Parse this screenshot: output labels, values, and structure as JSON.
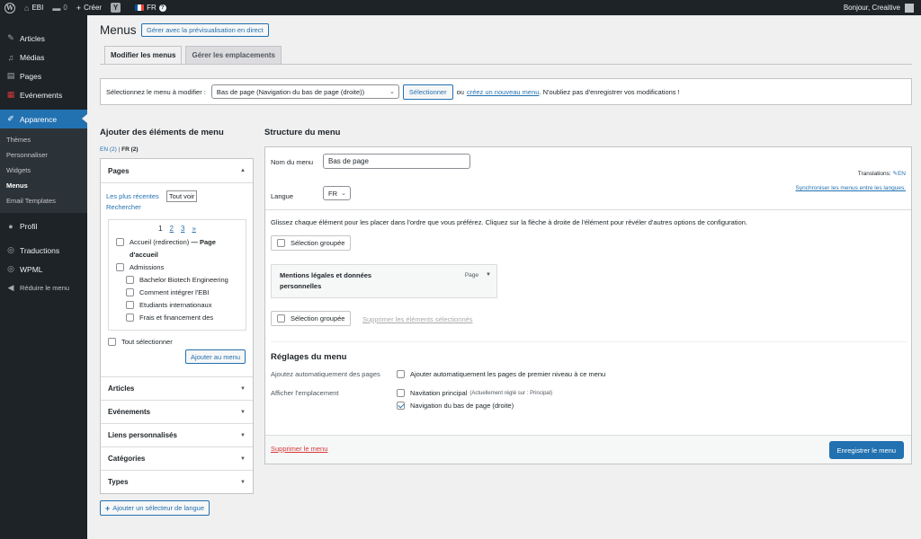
{
  "adminbar": {
    "site_name": "EBI",
    "comments_count": "0",
    "new_label": "Créer",
    "yoast_label": "Y",
    "lang_label": "FR",
    "greeting": "Bonjour, Creaitive"
  },
  "sidebar": {
    "items": [
      {
        "label": "Articles",
        "icon": "pin-icon"
      },
      {
        "label": "Médias",
        "icon": "media-icon"
      },
      {
        "label": "Pages",
        "icon": "pages-icon"
      },
      {
        "label": "Evénements",
        "icon": "calendar-icon"
      },
      {
        "label": "Apparence",
        "icon": "brush-icon"
      }
    ],
    "submenu": [
      "Thèmes",
      "Personnaliser",
      "Widgets",
      "Menus",
      "Email Templates"
    ],
    "items_after": [
      {
        "label": "Profil",
        "icon": "user-icon"
      },
      {
        "label": "Traductions",
        "icon": "translate-icon"
      },
      {
        "label": "WPML",
        "icon": "wpml-icon"
      },
      {
        "label": "Réduire le menu",
        "icon": "collapse-icon"
      }
    ]
  },
  "header": {
    "title": "Menus",
    "preview_button": "Gérer avec la prévisualisation en direct",
    "tabs": [
      "Modifier les menus",
      "Gérer les emplacements"
    ]
  },
  "manage": {
    "label": "Sélectionnez le menu à modifier :",
    "selected_menu": "Bas de page (Navigation du bas de page (droite))",
    "select_button": "Sélectionner",
    "or_text": "ou",
    "create_link": "créez un nouveau menu",
    "reminder": ". N'oubliez pas d'enregistrer vos modifications !"
  },
  "add_items": {
    "title": "Ajouter des éléments de menu",
    "lang_en": "EN (2)",
    "lang_sep": " | ",
    "lang_fr": "FR (2)",
    "pages_panel": {
      "title": "Pages",
      "tabs": [
        "Les plus récentes",
        "Tout voir",
        "Rechercher"
      ],
      "pager": [
        "1",
        "2",
        "3",
        "»"
      ],
      "pages": [
        {
          "label": "Accueil (redirection)",
          "suffix": " — Page d'accueil",
          "level": 0
        },
        {
          "label": "Admissions",
          "suffix": "",
          "level": 0
        },
        {
          "label": "Bachelor Biotech Engineering",
          "suffix": "",
          "level": 1
        },
        {
          "label": "Comment intégrer l'EBI",
          "suffix": "",
          "level": 1
        },
        {
          "label": "Etudiants internationaux",
          "suffix": "",
          "level": 1
        },
        {
          "label": "Frais et financement des",
          "suffix": "",
          "level": 1
        }
      ],
      "select_all": "Tout sélectionner",
      "add_button": "Ajouter au menu"
    },
    "other_panels": [
      "Articles",
      "Evénements",
      "Liens personnalisés",
      "Catégories",
      "Types"
    ],
    "language_switcher_button": "Ajouter un sélecteur de langue"
  },
  "structure": {
    "title": "Structure du menu",
    "name_label": "Nom du menu",
    "name_value": "Bas de page",
    "translations_label": "Translations:",
    "translations_lang": "EN",
    "lang_label": "Langue",
    "lang_value": "FR",
    "sync_link": "Synchroniser les menus entre les langues.",
    "instructions": "Glissez chaque élément pour les placer dans l'ordre que vous préférez. Cliquez sur la flèche à droite de l'élément pour révéler d'autres options de configuration.",
    "bulk_select": "Sélection groupée",
    "menu_items": [
      {
        "title": "Mentions légales et données personnelles",
        "type": "Page"
      }
    ],
    "delete_selected": "Supprimer les éléments sélectionnés",
    "settings_title": "Réglages du menu",
    "auto_add_label": "Ajoutez automatiquement des pages",
    "auto_add_option": "Ajouter automatiquement les pages de premier niveau à ce menu",
    "locations_label": "Afficher l'emplacement",
    "locations": [
      {
        "label": "Navitation principal",
        "note": "(Actuellement réglé sur : Principal)",
        "checked": false
      },
      {
        "label": "Navigation du bas de page (droite)",
        "note": "",
        "checked": true
      }
    ],
    "delete_menu": "Supprimer le menu",
    "save_button": "Enregistrer le menu"
  }
}
